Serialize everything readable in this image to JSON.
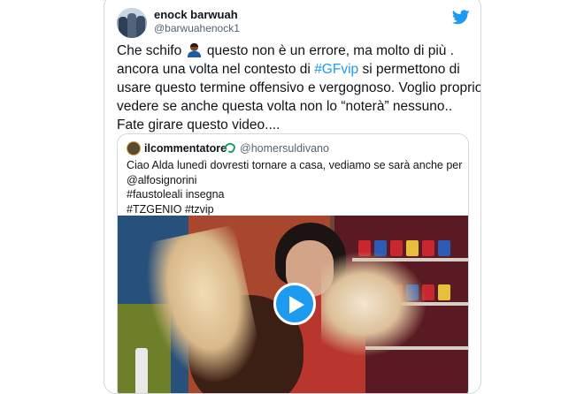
{
  "author": {
    "name": "enock barwuah",
    "handle": "@barwuahenock1"
  },
  "icons": {
    "twitter": "twitter-bird-icon",
    "emoji": "person-emoji-icon",
    "verified": "verified-badge-icon",
    "play": "play-icon"
  },
  "colors": {
    "brand": "#1d9bf0",
    "text": "#0f1419",
    "muted": "#536471",
    "border": "#cfd9de"
  },
  "tweet": {
    "line1_pre": "Che schifo",
    "line1_post": "questo non è un errore, ma molto di più .",
    "line2_pre": "ancora una volta nel contesto di",
    "line2_hashtag": "#GFvip",
    "line2_post": "si permettono di",
    "line3": "usare questo termine offensivo e vergognoso. Voglio proprio",
    "line4": "vedere se anche questa volta non lo “noterà” nessuno..",
    "line5": "Fate girare questo video...."
  },
  "quoted": {
    "name": "ilcommentatore",
    "handle": "@homersuldivano",
    "lines": [
      "Ciao Alda lunedì dovresti tornare a casa, vediamo se sarà anche per",
      "@alfosignorini",
      "#faustoleali insegna",
      "#TZGENIO #tzvip"
    ]
  }
}
